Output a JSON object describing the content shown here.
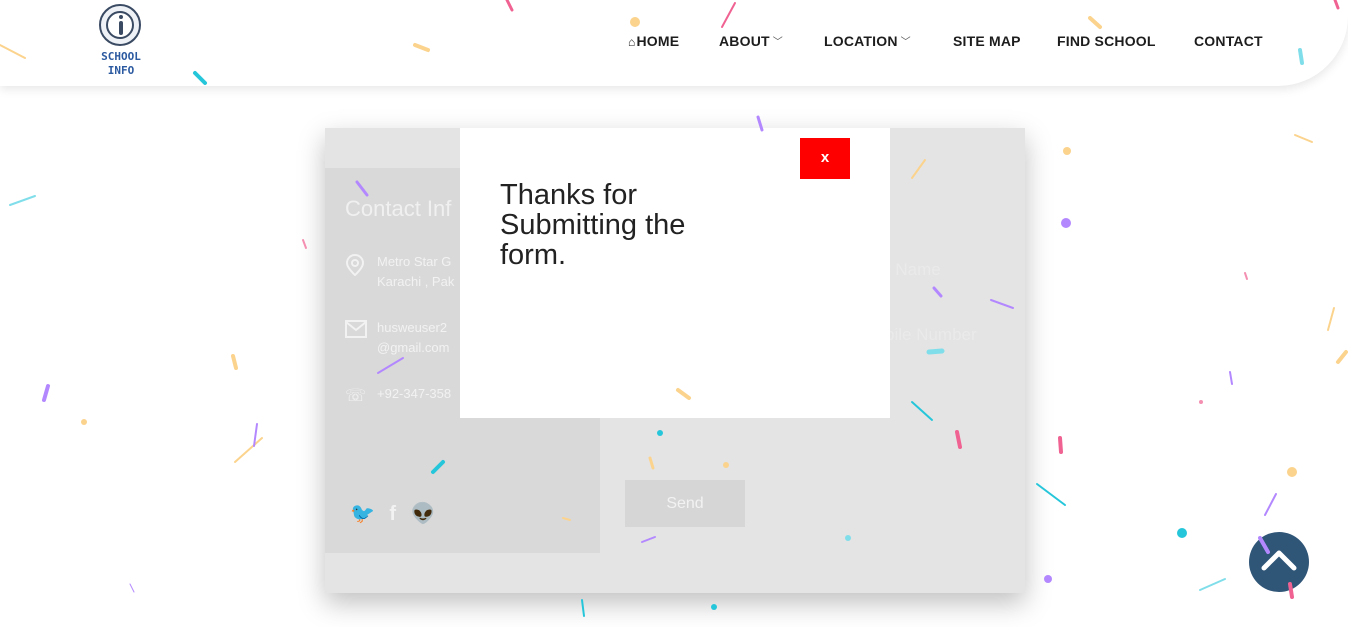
{
  "logo": {
    "line1": "SCHOOL",
    "line2": "INFO"
  },
  "nav": {
    "items": [
      {
        "label": "HOME",
        "icon": "home-icon",
        "dropdown": false
      },
      {
        "label": "ABOUT",
        "dropdown": true
      },
      {
        "label": "LOCATION",
        "dropdown": true
      },
      {
        "label": "SITE MAP",
        "dropdown": false
      },
      {
        "label": "FIND SCHOOL",
        "dropdown": false
      },
      {
        "label": "CONTACT",
        "dropdown": false
      }
    ]
  },
  "contact_card": {
    "title": "Contact Inf",
    "address_line1": "Metro Star G",
    "address_line2": "Karachi , Pak",
    "email_line1": "husweuser2",
    "email_line2": "@gmail.com",
    "phone": "+92-347-358",
    "field_name": "r Name",
    "field_phone": "bile Number",
    "send_label": "Send"
  },
  "modal": {
    "message": "Thanks for Submitting the form.",
    "close_label": "x"
  },
  "colors": {
    "close_button": "#ff0000",
    "scroll_top": "#2f5577",
    "logo_blue": "#2c5aa0"
  }
}
